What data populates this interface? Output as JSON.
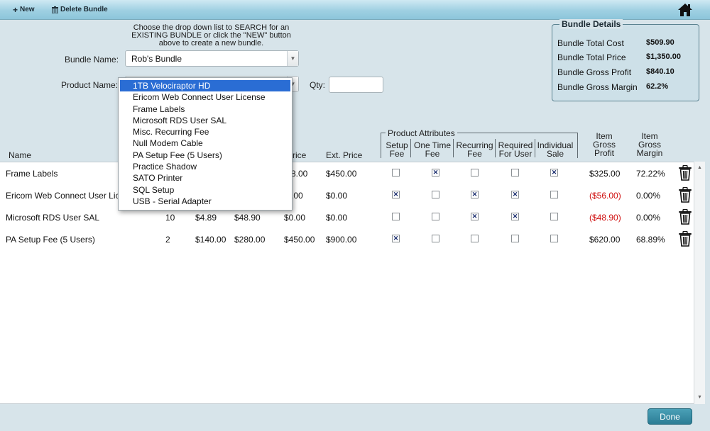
{
  "toolbar": {
    "new_label": "New",
    "delete_label": "Delete Bundle"
  },
  "instructions": "Choose the drop down list to SEARCH for an EXISTING BUNDLE or click the \"NEW\" button above to create a new bundle.",
  "bundle_name": {
    "label": "Bundle Name:",
    "value": "Rob's Bundle"
  },
  "product_name": {
    "label": "Product Name:",
    "value": "1TB Velociraptor HD"
  },
  "qty": {
    "label": "Qty:",
    "value": ""
  },
  "dropdown_options": [
    "1TB Velociraptor HD",
    "Ericom Web Connect User License",
    "Frame Labels",
    "Microsoft RDS User SAL",
    "Misc. Recurring Fee",
    "Null Modem Cable",
    "PA Setup Fee (5 Users)",
    "Practice Shadow",
    "SATO Printer",
    "SQL Setup",
    "USB - Serial Adapter"
  ],
  "bundle_details": {
    "title": "Bundle Details",
    "rows": [
      {
        "label": "Bundle Total Cost",
        "value": "$509.90"
      },
      {
        "label": "Bundle Total Price",
        "value": "$1,350.00"
      },
      {
        "label": "Bundle Gross Profit",
        "value": "$840.10"
      },
      {
        "label": "Bundle Gross Margin",
        "value": "62.2%"
      }
    ]
  },
  "table": {
    "headers": {
      "name": "Name",
      "price_partial": "rice",
      "ext_price": "Ext. Price",
      "attributes_group": "Product Attributes",
      "setup_fee": "Setup Fee",
      "one_time_fee": "One Time Fee",
      "recurring_fee": "Recurring Fee",
      "required_for_user": "Required For User",
      "individual_sale": "Individual Sale",
      "item_gross_profit": "Item Gross Profit",
      "item_gross_margin": "Item Gross Margin"
    },
    "rows": [
      {
        "name": "Frame Labels",
        "qty": "",
        "cost": "",
        "ext_cost": "",
        "price": "8.00",
        "ext_price": "$450.00",
        "setup": false,
        "one_time": true,
        "recurring": false,
        "required": false,
        "individual": true,
        "profit": "$325.00",
        "profit_negative": false,
        "margin": "72.22%"
      },
      {
        "name": "Ericom Web Connect User License",
        "qty": "",
        "cost": "",
        "ext_cost": "",
        "price": ".00",
        "ext_price": "$0.00",
        "setup": true,
        "one_time": false,
        "recurring": true,
        "required": true,
        "individual": false,
        "profit": "($56.00)",
        "profit_negative": true,
        "margin": "0.00%"
      },
      {
        "name": "Microsoft RDS User SAL",
        "qty": "10",
        "cost": "$4.89",
        "ext_cost": "$48.90",
        "price": "$0.00",
        "ext_price": "$0.00",
        "setup": false,
        "one_time": false,
        "recurring": true,
        "required": true,
        "individual": false,
        "profit": "($48.90)",
        "profit_negative": true,
        "margin": "0.00%"
      },
      {
        "name": "PA Setup Fee (5 Users)",
        "qty": "2",
        "cost": "$140.00",
        "ext_cost": "$280.00",
        "price": "$450.00",
        "ext_price": "$900.00",
        "setup": true,
        "one_time": false,
        "recurring": false,
        "required": false,
        "individual": false,
        "profit": "$620.00",
        "profit_negative": false,
        "margin": "68.89%"
      }
    ]
  },
  "done_label": "Done",
  "colors": {
    "accent": "#2c7d95",
    "negative": "#d01010",
    "selection": "#2a6dd4"
  }
}
